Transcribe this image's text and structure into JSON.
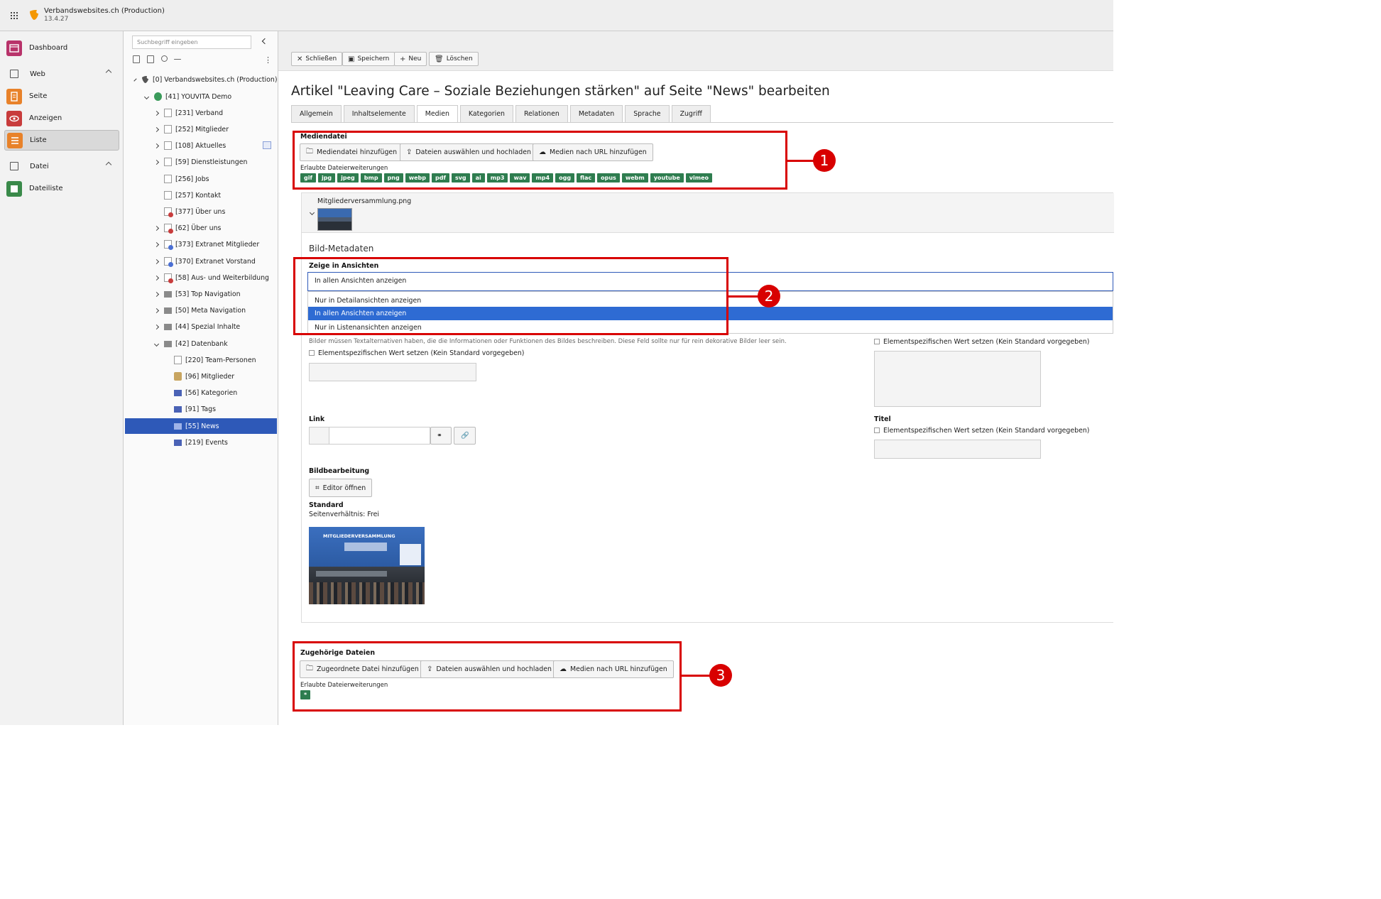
{
  "topbar": {
    "site_name": "Verbandswebsites.ch (Production)",
    "version": "13.4.27"
  },
  "modules": {
    "dashboard": "Dashboard",
    "web": "Web",
    "seite": "Seite",
    "anzeigen": "Anzeigen",
    "liste": "Liste",
    "datei": "Datei",
    "dateiliste": "Dateiliste"
  },
  "pagetree": {
    "search_placeholder": "Suchbegriff eingeben",
    "nodes": [
      {
        "label": "[0] Verbandswebsites.ch (Production)"
      },
      {
        "label": "[41] YOUVITA Demo"
      },
      {
        "label": "[231] Verband"
      },
      {
        "label": "[252] Mitglieder"
      },
      {
        "label": "[108] Aktuelles"
      },
      {
        "label": "[59] Dienstleistungen"
      },
      {
        "label": "[256] Jobs"
      },
      {
        "label": "[257] Kontakt"
      },
      {
        "label": "[377] Über uns"
      },
      {
        "label": "[62] Über uns"
      },
      {
        "label": "[373] Extranet Mitglieder"
      },
      {
        "label": "[370] Extranet Vorstand"
      },
      {
        "label": "[58] Aus- und Weiterbildung"
      },
      {
        "label": "[53] Top Navigation"
      },
      {
        "label": "[50] Meta Navigation"
      },
      {
        "label": "[44] Spezial Inhalte"
      },
      {
        "label": "[42] Datenbank"
      },
      {
        "label": "[220] Team-Personen"
      },
      {
        "label": "[96] Mitglieder"
      },
      {
        "label": "[56] Kategorien"
      },
      {
        "label": "[91] Tags"
      },
      {
        "label": "[55] News"
      },
      {
        "label": "[219] Events"
      }
    ]
  },
  "toolbar": {
    "close": "Schließen",
    "save": "Speichern",
    "new": "Neu",
    "delete": "Löschen"
  },
  "page_title": "Artikel \"Leaving Care – Soziale Beziehungen stärken\" auf Seite \"News\" bearbeiten",
  "tabs": [
    "Allgemein",
    "Inhaltselemente",
    "Medien",
    "Kategorien",
    "Relationen",
    "Metadaten",
    "Sprache",
    "Zugriff"
  ],
  "mediendatei": {
    "label": "Mediendatei",
    "btn_add": "Mediendatei hinzufügen",
    "btn_upload": "Dateien auswählen und hochladen",
    "btn_url": "Medien nach URL hinzufügen",
    "allowed_label": "Erlaubte Dateierweiterungen",
    "extensions": [
      "gif",
      "jpg",
      "jpeg",
      "bmp",
      "png",
      "webp",
      "pdf",
      "svg",
      "ai",
      "mp3",
      "wav",
      "mp4",
      "ogg",
      "flac",
      "opus",
      "webm",
      "youtube",
      "vimeo"
    ]
  },
  "media_item": {
    "filename": "Mitgliederversammlung.png",
    "metadata_title": "Bild-Metadaten",
    "show_in_views_label": "Zeige in Ansichten",
    "selected_value": "In allen Ansichten anzeigen",
    "options": [
      "Nur in Detailansichten anzeigen",
      "In allen Ansichten anzeigen",
      "Nur in Listenansichten anzeigen"
    ],
    "alt_help": "Bilder müssen Textalternativen haben, die die Informationen oder Funktionen des Bildes beschreiben. Diese Feld sollte nur für rein dekorative Bilder leer sein.",
    "element_specific": "Elementspezifischen Wert setzen (Kein Standard vorgegeben)",
    "link_label": "Link",
    "titel_label": "Titel",
    "bildbearbeitung_label": "Bildbearbeitung",
    "editor_btn": "Editor öffnen",
    "standard_label": "Standard",
    "aspect_ratio": "Seitenverhältnis: Frei",
    "image_banner": "MITGLIEDERVERSAMMLUNG"
  },
  "zugehoerige": {
    "label": "Zugehörige Dateien",
    "btn_add": "Zugeordnete Datei hinzufügen",
    "btn_upload": "Dateien auswählen und hochladen",
    "btn_url": "Medien nach URL hinzufügen",
    "allowed_label": "Erlaubte Dateierweiterungen",
    "extension": "*"
  },
  "callouts": [
    "1",
    "2",
    "3"
  ],
  "colors": {
    "accent": "#2e59b8",
    "badge": "#2e7d4f",
    "highlight": "#d80000"
  }
}
